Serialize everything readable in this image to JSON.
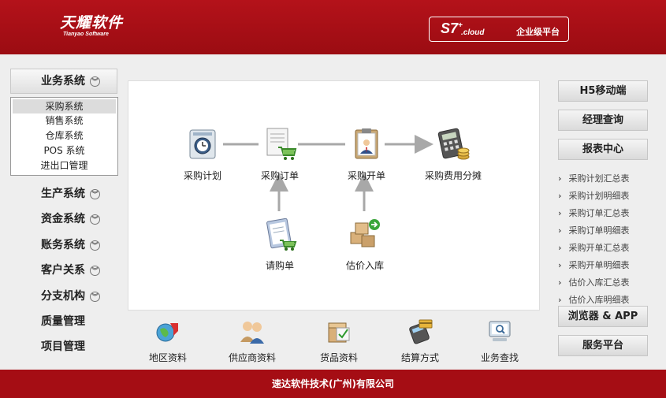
{
  "header": {
    "logo_cn": "天耀软件",
    "logo_en": "Tianyao Software",
    "product_name": "S7",
    "product_sup": "+",
    "product_cloud": ".cloud",
    "product_desc": "企业级平台"
  },
  "sidebar": {
    "title": "业务系统",
    "submenu": [
      "采购系统",
      "销售系统",
      "仓库系统",
      "POS 系统",
      "进出口管理"
    ],
    "items": [
      {
        "label": "生产系统",
        "expandable": true
      },
      {
        "label": "资金系统",
        "expandable": true
      },
      {
        "label": "账务系统",
        "expandable": true
      },
      {
        "label": "客户关系",
        "expandable": true
      },
      {
        "label": "分支机构",
        "expandable": true
      },
      {
        "label": "质量管理",
        "expandable": false
      },
      {
        "label": "项目管理",
        "expandable": false
      }
    ]
  },
  "flow": {
    "nodes": [
      "采购计划",
      "采购订单",
      "采购开单",
      "采购费用分摊",
      "请购单",
      "估价入库"
    ]
  },
  "bottom": {
    "items": [
      "地区资料",
      "供应商资料",
      "货品资料",
      "结算方式",
      "业务查找"
    ]
  },
  "right": {
    "h5_button": "H5移动端",
    "manager_button": "经理查询",
    "report_center": "报表中心",
    "reports": [
      "采购计划汇总表",
      "采购计划明细表",
      "采购订单汇总表",
      "采购订单明细表",
      "采购开单汇总表",
      "采购开单明细表",
      "估价入库汇总表",
      "估价入库明细表"
    ],
    "browser_app_button": "浏览器 & APP",
    "service_button": "服务平台"
  },
  "footer": {
    "text": "速达软件技术(广州)有限公司"
  },
  "colors": {
    "brand_red": "#a50d14",
    "panel_bg": "#eeeeee"
  }
}
